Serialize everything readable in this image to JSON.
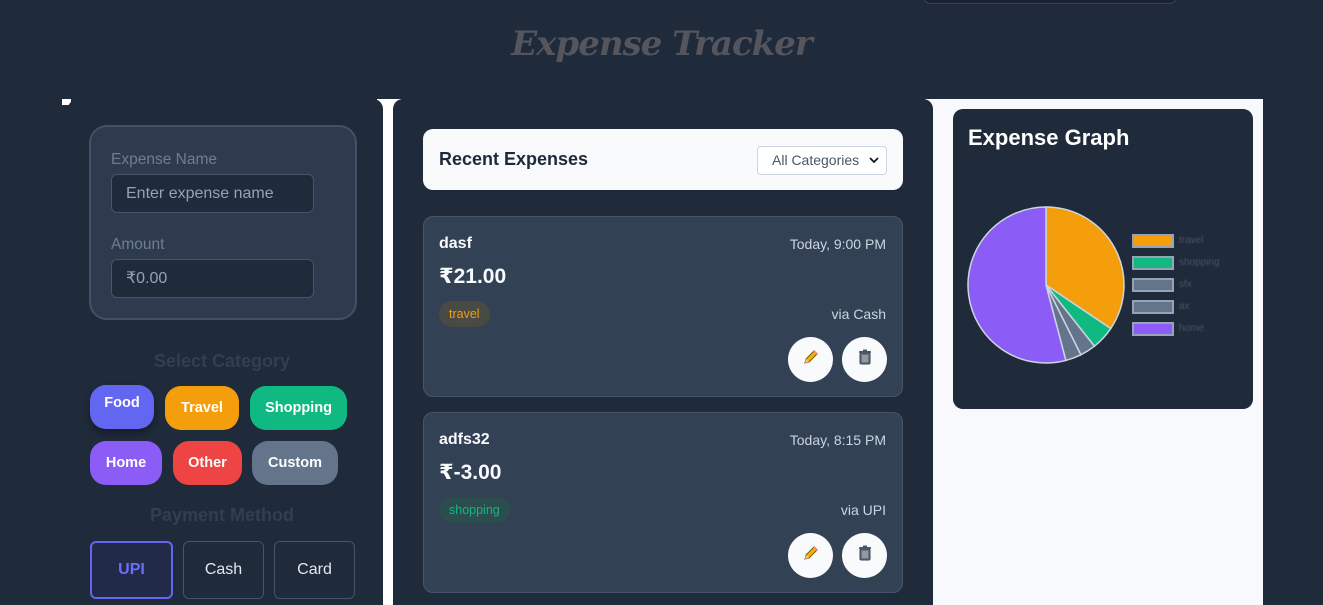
{
  "app": {
    "title": "Expense Tracker"
  },
  "form": {
    "name_label": "Expense Name",
    "name_placeholder": "Enter expense name",
    "amount_label": "Amount",
    "amount_placeholder": "₹0.00"
  },
  "category_section": {
    "heading": "Select Category",
    "chips": [
      {
        "label": "Food",
        "color": "#6366f1"
      },
      {
        "label": "Travel",
        "color": "#f59e0b"
      },
      {
        "label": "Shopping",
        "color": "#10b981"
      },
      {
        "label": "Home",
        "color": "#8b5cf6"
      },
      {
        "label": "Other",
        "color": "#ef4444"
      },
      {
        "label": "Custom",
        "color": "#64748b"
      }
    ]
  },
  "payment_section": {
    "heading": "Payment Method",
    "methods": [
      {
        "label": "UPI",
        "selected": true
      },
      {
        "label": "Cash",
        "selected": false
      },
      {
        "label": "Card",
        "selected": false
      }
    ]
  },
  "recent": {
    "title": "Recent Expenses",
    "filter_value": "All Categories",
    "expenses": [
      {
        "name": "dasf",
        "time": "Today, 9:00 PM",
        "amount": "₹21.00",
        "category": "travel",
        "method": "via Cash"
      },
      {
        "name": "adfs32",
        "time": "Today, 8:15 PM",
        "amount": "₹-3.00",
        "category": "shopping",
        "method": "via UPI"
      }
    ]
  },
  "graph": {
    "title": "Expense Graph",
    "legend": [
      {
        "label": "travel",
        "color": "#f59e0b"
      },
      {
        "label": "shopping",
        "color": "#10b981"
      },
      {
        "label": "sfx",
        "color": "#64748b"
      },
      {
        "label": "ax",
        "color": "#64748b"
      },
      {
        "label": "home",
        "color": "#8b5cf6"
      }
    ]
  },
  "chart_data": {
    "type": "pie",
    "categories": [
      "travel",
      "shopping",
      "sfx",
      "ax",
      "home"
    ],
    "values": [
      21,
      3,
      2,
      2,
      33
    ],
    "colors": [
      "#f59e0b",
      "#10b981",
      "#64748b",
      "#64748b",
      "#8b5cf6"
    ],
    "title": "Expense Graph",
    "legend": "right"
  },
  "icons": {
    "edit": "pencil-icon",
    "delete": "trash-icon"
  }
}
